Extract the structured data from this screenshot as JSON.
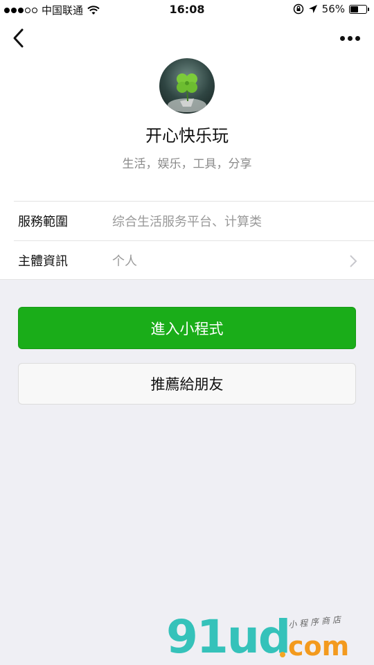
{
  "status_bar": {
    "carrier": "中国联通",
    "time": "16:08",
    "battery": "56%",
    "battery_level": 0.56
  },
  "profile": {
    "name": "开心快乐玩",
    "tags": "生活，娱乐，工具，分享"
  },
  "info": [
    {
      "label": "服務範圍",
      "value": "综合生活服务平台、计算类"
    },
    {
      "label": "主體資訊",
      "value": "个人"
    }
  ],
  "buttons": {
    "enter": "進入小程式",
    "recommend": "推薦給朋友"
  },
  "watermark": {
    "main": "91ud",
    "suffix": "com",
    "sub": "小程序商店"
  },
  "colors": {
    "primary": "#1aad19",
    "background": "#efeff4"
  }
}
